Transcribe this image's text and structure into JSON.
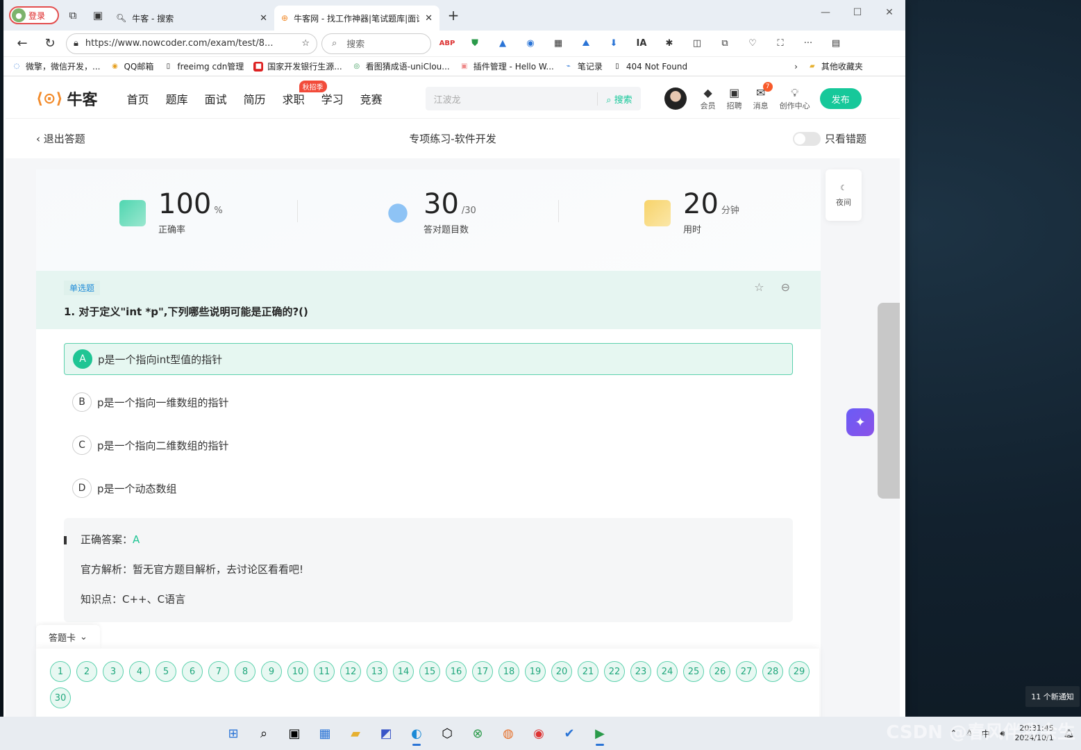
{
  "browser": {
    "login_label": "登录",
    "tabs": [
      {
        "title": "牛客 - 搜索"
      },
      {
        "title": "牛客网 - 找工作神器|笔试题库|面试"
      }
    ],
    "url": "https://www.nowcoder.com/exam/test/8...",
    "search_placeholder": "搜索",
    "bookmarks": [
      "微擎，微信开发，...",
      "QQ邮箱",
      "freeimg cdn管理",
      "国家开发银行生源...",
      "看图猜成语-uniClou...",
      "插件管理 - Hello W...",
      "笔记录",
      "404 Not Found"
    ],
    "other_bookmarks": "其他收藏夹"
  },
  "site": {
    "logo": "牛客",
    "nav": [
      "首页",
      "题库",
      "面试",
      "简历",
      "求职",
      "学习",
      "竞赛"
    ],
    "nav_badge": "秋招季",
    "search_placeholder": "江波龙",
    "search_button": "搜索",
    "icons": [
      {
        "label": "会员"
      },
      {
        "label": "招聘"
      },
      {
        "label": "消息",
        "count": "7"
      },
      {
        "label": "创作中心"
      }
    ],
    "publish": "发布"
  },
  "exam": {
    "back": "退出答题",
    "title": "专项练习-软件开发",
    "wrong_only": "只看错题",
    "night": "夜间",
    "stats": [
      {
        "value": "100",
        "unit": "%",
        "label": "正确率"
      },
      {
        "value": "30",
        "unit": "/30",
        "label": "答对题目数"
      },
      {
        "value": "20",
        "unit": "分钟",
        "label": "用时"
      }
    ],
    "question": {
      "type": "单选题",
      "text": "1. 对于定义\"int *p\",下列哪些说明可能是正确的?()",
      "options": [
        {
          "letter": "A",
          "text": "p是一个指向int型值的指针",
          "selected": true
        },
        {
          "letter": "B",
          "text": "p是一个指向一维数组的指针",
          "selected": false
        },
        {
          "letter": "C",
          "text": "p是一个指向二维数组的指针",
          "selected": false
        },
        {
          "letter": "D",
          "text": "p是一个动态数组",
          "selected": false
        }
      ]
    },
    "answer": {
      "correct_label": "正确答案：",
      "correct_value": "A",
      "analysis": "官方解析：暂无官方题目解析，去讨论区看看吧!",
      "knowledge": "知识点：C++、C语言"
    },
    "answer_card_label": "答题卡",
    "question_numbers": [
      "1",
      "2",
      "3",
      "4",
      "5",
      "6",
      "7",
      "8",
      "9",
      "10",
      "11",
      "12",
      "13",
      "14",
      "15",
      "16",
      "17",
      "18",
      "19",
      "20",
      "21",
      "22",
      "23",
      "24",
      "25",
      "26",
      "27",
      "28",
      "29",
      "30"
    ]
  },
  "taskbar": {
    "ime": "中",
    "time": "20:31:45",
    "date": "2024/10/1",
    "notification": "11 个新通知",
    "watermark": "CSDN @春风伴我余生"
  }
}
